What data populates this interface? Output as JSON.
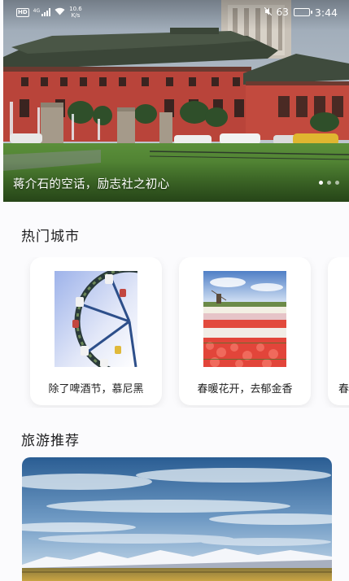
{
  "status_bar": {
    "hd": "HD",
    "network": "4G",
    "speed_value": "10.6",
    "speed_unit": "K/s",
    "battery_percent": "63",
    "battery_level": 0.63,
    "time": "3:44"
  },
  "hero": {
    "caption": "蒋介石的空话，励志社之初心",
    "slide_count": 3,
    "active_slide": 0
  },
  "hot_cities": {
    "title": "热门城市",
    "items": [
      {
        "label": "除了啤酒节，慕尼黑",
        "image": "ferris-wheel"
      },
      {
        "label": "春暖花开，去郁金香",
        "image": "tulip-field"
      },
      {
        "label": "春",
        "image": ""
      }
    ]
  },
  "travel_recommend": {
    "title": "旅游推荐",
    "image": "mountain-landscape"
  },
  "colors": {
    "page_bg": "#fbfbfd",
    "card_bg": "#ffffff",
    "text": "#1d1d1f",
    "hero_wall": "#b9443a",
    "hero_roof": "#3d4a3a"
  }
}
